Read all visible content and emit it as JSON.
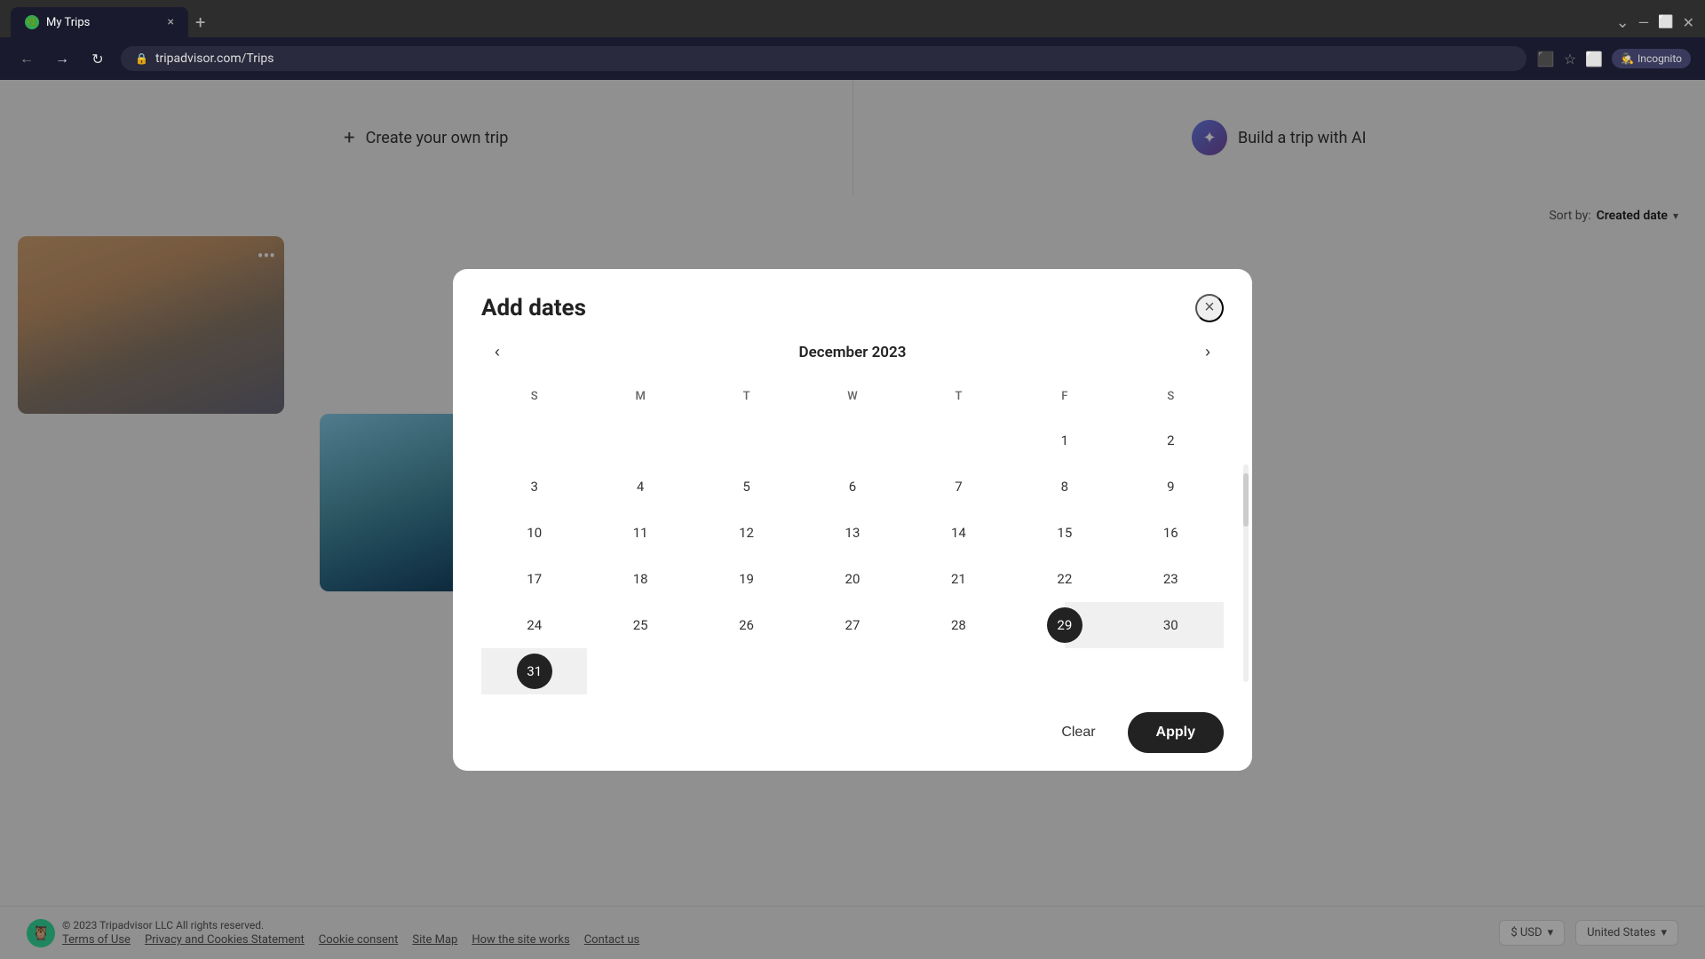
{
  "browser": {
    "tab_title": "My Trips",
    "tab_favicon": "🌿",
    "new_tab_icon": "+",
    "close_tab_icon": "×",
    "address": "tripadvisor.com/Trips",
    "incognito_label": "Incognito",
    "back_icon": "←",
    "forward_icon": "→",
    "refresh_icon": "↻",
    "lock_icon": "🔒"
  },
  "page": {
    "create_trip_label": "Create your own trip",
    "build_ai_label": "Build a trip with AI",
    "sort_label": "Sort by:",
    "sort_value": "Created date",
    "sort_chevron": "▾"
  },
  "modal": {
    "title": "Add dates",
    "close_icon": "×",
    "calendar": {
      "month_title": "December 2023",
      "prev_icon": "‹",
      "next_icon": "›",
      "day_headers": [
        "S",
        "M",
        "T",
        "W",
        "T",
        "F",
        "S"
      ],
      "weeks": [
        [
          null,
          null,
          null,
          null,
          null,
          1,
          2
        ],
        [
          3,
          4,
          5,
          6,
          7,
          8,
          9
        ],
        [
          10,
          11,
          12,
          13,
          14,
          15,
          16
        ],
        [
          17,
          18,
          19,
          20,
          21,
          22,
          23
        ],
        [
          24,
          25,
          26,
          27,
          28,
          29,
          30
        ],
        [
          31,
          null,
          null,
          null,
          null,
          null,
          null
        ]
      ],
      "selected_start": 29,
      "selected_end": 31
    },
    "clear_label": "Clear",
    "apply_label": "Apply"
  },
  "footer": {
    "copyright": "© 2023 Tripadvisor LLC All rights reserved.",
    "links": [
      "Terms of Use",
      "Privacy and Cookies Statement",
      "Cookie consent",
      "Site Map"
    ],
    "links_second_row": [
      "How the site works",
      "Contact us"
    ],
    "currency": "$ USD",
    "country": "United States",
    "dropdown_icon": "▾"
  }
}
